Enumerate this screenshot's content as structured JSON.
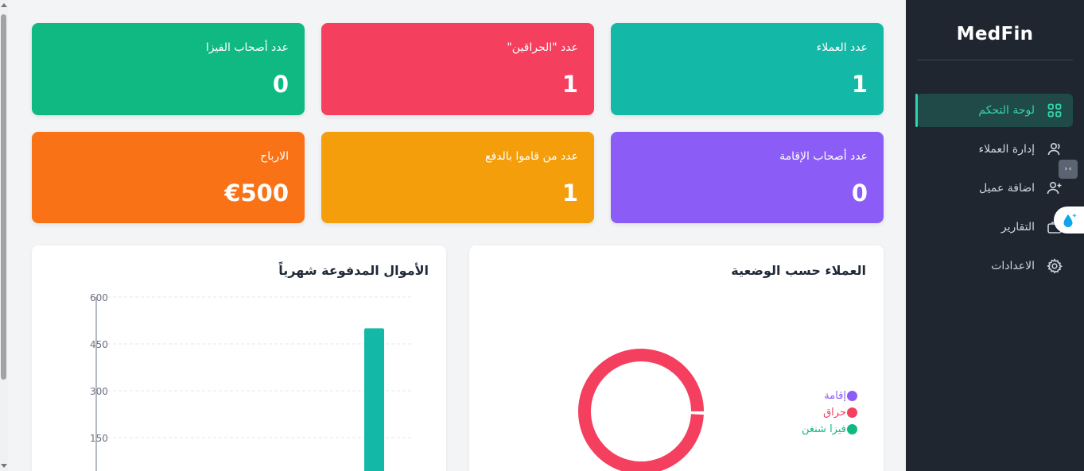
{
  "app": {
    "brand": "MedFin"
  },
  "sidebar": {
    "items": [
      {
        "label": "لوحة التحكم",
        "icon": "grid-icon",
        "active": true
      },
      {
        "label": "إدارة العملاء",
        "icon": "users-icon",
        "active": false
      },
      {
        "label": "اضافة عميل",
        "icon": "user-plus-icon",
        "active": false
      },
      {
        "label": "التقارير",
        "icon": "briefcase-icon",
        "active": false
      },
      {
        "label": "الاعدادات",
        "icon": "gear-icon",
        "active": false
      }
    ]
  },
  "widgets": {
    "code_badge": "›‹"
  },
  "stats": {
    "clients": {
      "label": "عدد العملاء",
      "value": "1",
      "color": "#14b8a6"
    },
    "harraga": {
      "label": "عدد \"الحراقين\"",
      "value": "1",
      "color": "#f43f5e"
    },
    "visa": {
      "label": "عدد أصحاب الفيزا",
      "value": "0",
      "color": "#10b981"
    },
    "residence": {
      "label": "عدد أصحاب الإقامة",
      "value": "0",
      "color": "#8b5cf6"
    },
    "paid": {
      "label": "عدد من قاموا بالدفع",
      "value": "1",
      "color": "#f59e0b"
    },
    "profits": {
      "label": "الارباح",
      "value": "€500",
      "color": "#f97316"
    }
  },
  "donut_panel": {
    "title": "العملاء حسب الوضعية",
    "legend": [
      {
        "label": "إقامة",
        "color": "#8b5cf6"
      },
      {
        "label": "حراق",
        "color": "#f43f5e"
      },
      {
        "label": "فيزا شنغن",
        "color": "#10b981"
      }
    ]
  },
  "bar_panel": {
    "title": "الأموال المدفوعة شهرياً"
  },
  "chart_data": [
    {
      "type": "pie",
      "title": "العملاء حسب الوضعية",
      "categories": [
        "إقامة",
        "حراق",
        "فيزا شنغن"
      ],
      "values": [
        0,
        1,
        0
      ],
      "colors": [
        "#8b5cf6",
        "#f43f5e",
        "#10b981"
      ],
      "legend": "right"
    },
    {
      "type": "bar",
      "title": "الأموال المدفوعة شهرياً",
      "values": [
        500
      ],
      "ylim": [
        0,
        600
      ],
      "yticks": [
        150,
        300,
        450,
        600
      ],
      "grid": true,
      "color": "#14b8a6"
    }
  ]
}
